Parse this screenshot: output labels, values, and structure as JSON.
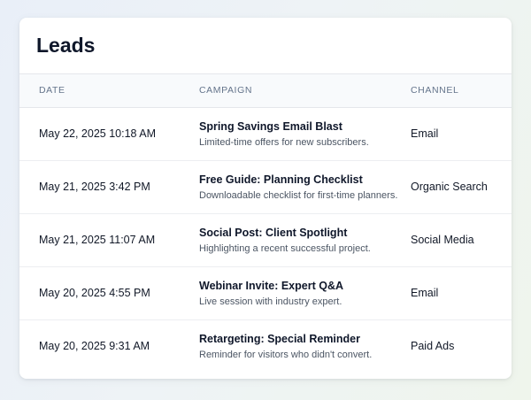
{
  "page": {
    "title": "Leads"
  },
  "table": {
    "headers": {
      "date": "DATE",
      "campaign": "CAMPAIGN",
      "channel": "CHANNEL"
    },
    "rows": [
      {
        "date": "May 22, 2025 10:18 AM",
        "campaign": "Spring Savings Email Blast",
        "description": "Limited-time offers for new subscribers.",
        "channel": "Email"
      },
      {
        "date": "May 21, 2025 3:42 PM",
        "campaign": "Free Guide: Planning Checklist",
        "description": "Downloadable checklist for first-time planners.",
        "channel": "Organic Search"
      },
      {
        "date": "May 21, 2025 11:07 AM",
        "campaign": "Social Post: Client Spotlight",
        "description": "Highlighting a recent successful project.",
        "channel": "Social Media"
      },
      {
        "date": "May 20, 2025 4:55 PM",
        "campaign": "Webinar Invite: Expert Q&A",
        "description": "Live session with industry expert.",
        "channel": "Email"
      },
      {
        "date": "May 20, 2025 9:31 AM",
        "campaign": "Retargeting: Special Reminder",
        "description": "Reminder for visitors who didn't convert.",
        "channel": "Paid Ads"
      }
    ]
  }
}
